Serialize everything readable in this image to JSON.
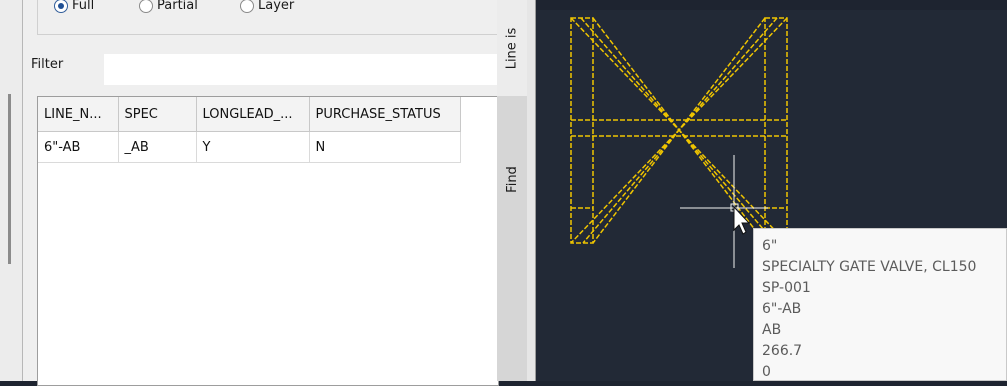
{
  "options": {
    "full_label": "Full",
    "partial_label": "Partial",
    "layer_label": "Layer",
    "selected": "Full"
  },
  "filter": {
    "label": "Filter",
    "value": ""
  },
  "table": {
    "headers": [
      "LINE_N...",
      "SPEC",
      "LONGLEAD_...",
      "PURCHASE_STATUS"
    ],
    "rows": [
      [
        "6\"-AB",
        "_AB",
        "Y",
        "N"
      ]
    ]
  },
  "side_tabs": {
    "line_tab": "Line is",
    "find_tab": "Find"
  },
  "tooltip": {
    "size": "6\"",
    "description": "SPECIALTY GATE VALVE, CL150",
    "item_code": "SP-001",
    "line": "6\"-AB",
    "spec": "AB",
    "value": "266.7",
    "extra": "0"
  },
  "colors": {
    "drawing_accent": "#f0c500",
    "canvas_background": "#222936",
    "panel_background": "#efefef"
  }
}
